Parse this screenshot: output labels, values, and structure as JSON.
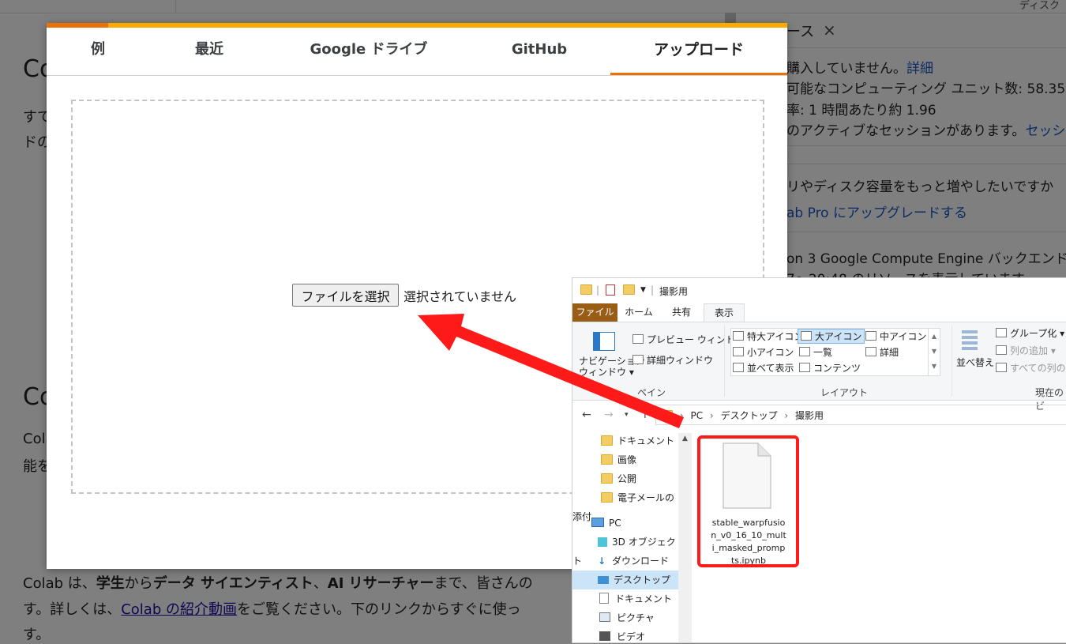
{
  "background": {
    "top_right": "ディスク",
    "heading_1": "Co",
    "para_1": [
      "すで",
      "ドの"
    ],
    "heading_2": "Co",
    "para_2": [
      "Colab",
      "能を"
    ],
    "intro_line": {
      "t1": "Colab は、",
      "t2": "学生",
      "t3": "から",
      "t4": "データ サイエンティスト",
      "t5": "、",
      "t6": "AI リサーチャー",
      "t7": "まで、皆さんの"
    },
    "intro_line2": {
      "t1": "す。詳しくは、",
      "link": "Colab の紹介動画",
      "t2": "をご覧ください。下のリンクからすぐに使っ"
    },
    "intro_line3": "す。",
    "panel": {
      "title": "ース",
      "close": "×",
      "line1": "購入していません。",
      "line1_link": "詳細",
      "line2": "可能なコンピューティング ユニット数: 58.35",
      "line3": "率: 1 時間あたり約 1.96",
      "line4": "のアクティブなセッションがあります。",
      "line4_link": "セッシ",
      "line5": "リやディスク容量をもっと増やしたいですか",
      "line6_link": "ab Pro にアップグレードする",
      "line7": "on 3 Google Compute Engine バックエンド (G",
      "line8": "7〜20:48 のリソースを表示しています"
    }
  },
  "dialog": {
    "tabs": [
      "例",
      "最近",
      "Google ドライブ",
      "GitHub",
      "アップロード"
    ],
    "active_tab": "アップロード",
    "file_button": "ファイルを選択",
    "file_status": "選択されていません"
  },
  "explorer": {
    "title": "撮影用",
    "ribbon_tabs": [
      "ファイル",
      "ホーム",
      "共有",
      "表示"
    ],
    "pane_group": {
      "nav_pane": "ナビゲーション\nウィンドウ",
      "nav_pane_l1": "ナビゲーション",
      "nav_pane_l2": "ウィンドウ",
      "preview": "プレビュー ウィンドウ",
      "details": "詳細ウィンドウ",
      "label": "ペイン"
    },
    "layout_group": {
      "items": [
        "特大アイコン",
        "大アイコン",
        "中アイコン",
        "小アイコン",
        "一覧",
        "詳細",
        "並べて表示",
        "コンテンツ"
      ],
      "selected": "大アイコン",
      "label": "レイアウト"
    },
    "view_group": {
      "sort": "並べ替え",
      "group_by": "グループ化",
      "add_column": "列の追加",
      "fit_columns": "すべての列のサ",
      "label": "現在のビ"
    },
    "breadcrumb": [
      "PC",
      "デスクトップ",
      "撮影用"
    ],
    "nav_items": [
      "ドキュメント",
      "画像",
      "公開",
      "電子メールの添付",
      "PC",
      "3D オブジェクト",
      "ダウンロード",
      "デスクトップ",
      "ドキュメント",
      "ピクチャ",
      "ビデオ"
    ],
    "selected_nav": "デスクトップ",
    "file_name": "stable_warpfusion_v0_16_10_multi_masked_prompts.ipynb"
  },
  "colors": {
    "accent_orange": "#e8710a",
    "tab_bar_yellow": "#f9ab00",
    "highlight_red": "#ff1a1a",
    "explorer_file_tab": "#9a5d15"
  }
}
